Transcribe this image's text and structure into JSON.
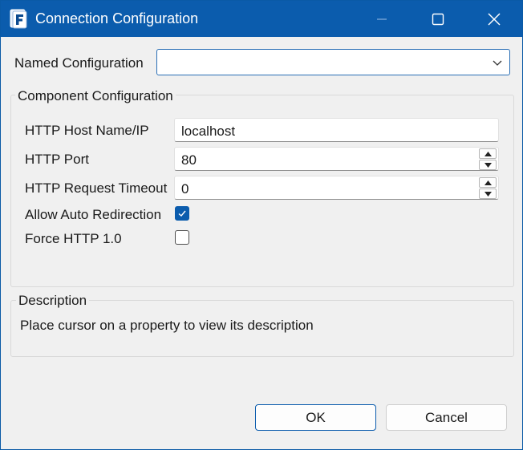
{
  "window": {
    "title": "Connection Configuration",
    "icon": "app-f-icon",
    "controls": {
      "minimize": "minimize-icon",
      "maximize": "maximize-icon",
      "close": "close-icon"
    },
    "accent_color": "#0b5cad"
  },
  "named_configuration": {
    "label": "Named Configuration",
    "value": ""
  },
  "component_configuration": {
    "title": "Component Configuration",
    "host": {
      "label": "HTTP Host Name/IP",
      "value": "localhost"
    },
    "port": {
      "label": "HTTP Port",
      "value": "80"
    },
    "timeout": {
      "label": "HTTP Request Timeout",
      "value": "0"
    },
    "auto_redirect": {
      "label": "Allow Auto Redirection",
      "checked": true
    },
    "force_http10": {
      "label": "Force HTTP 1.0",
      "checked": false
    }
  },
  "description": {
    "title": "Description",
    "text": "Place cursor on a property to view its description"
  },
  "buttons": {
    "ok": "OK",
    "cancel": "Cancel"
  }
}
